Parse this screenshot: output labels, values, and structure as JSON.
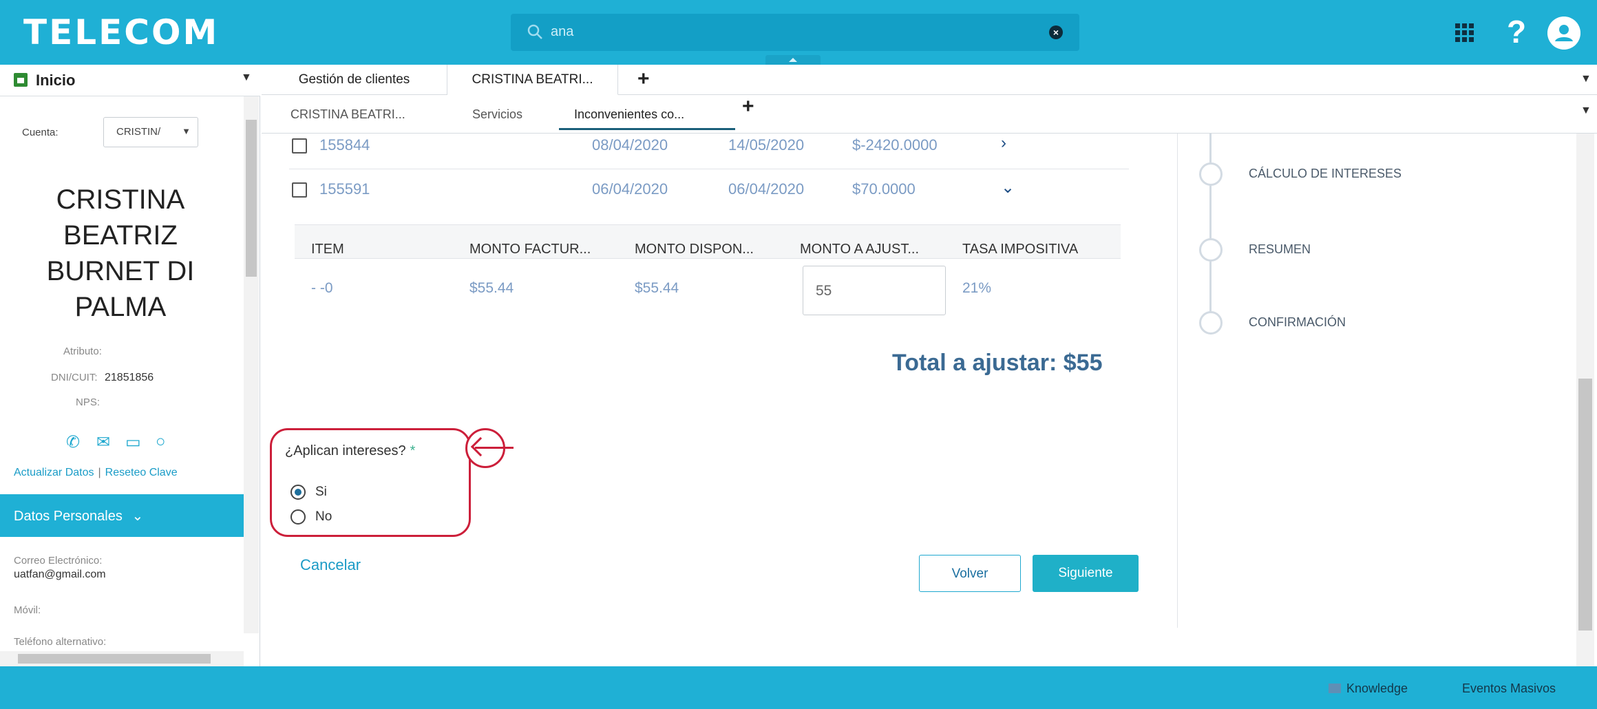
{
  "header": {
    "brand": "TELECOM",
    "search_value": "ana",
    "help_glyph": "?",
    "icons": [
      "search-icon",
      "clear-icon",
      "app-launcher-icon",
      "help-icon",
      "user-avatar-icon"
    ]
  },
  "left_panel": {
    "title": "Inicio",
    "cuenta_label": "Cuenta:",
    "cuenta_value": "CRISTIN/",
    "client_name": "CRISTINA BEATRIZ BURNET DI PALMA",
    "atributo_label": "Atributo:",
    "dni_label": "DNI/CUIT:",
    "dni_value": "21851856",
    "nps_label": "NPS:",
    "link_update": "Actualizar Datos",
    "link_separator": "|",
    "link_reset": "Reseteo Clave",
    "section_title": "Datos Personales",
    "email_label": "Correo Electrónico:",
    "email_value": "uatfan@gmail.com",
    "mobile_label": "Móvil:",
    "alt_phone_label": "Teléfono alternativo:"
  },
  "tabs_primary": [
    "Gestión de clientes",
    "CRISTINA BEATRI..."
  ],
  "tabs_secondary": [
    "CRISTINA BEATRI...",
    "Servicios",
    "Inconvenientes co..."
  ],
  "service_rows": [
    {
      "id": "155844",
      "date1": "08/04/2020",
      "date2": "14/05/2020",
      "amount": "$-2420.0000",
      "chevron": "›"
    },
    {
      "id": "155591",
      "date1": "06/04/2020",
      "date2": "06/04/2020",
      "amount": "$70.0000",
      "chevron": "⌄"
    }
  ],
  "detail_table": {
    "columns": [
      "ITEM",
      "MONTO FACTUR...",
      "MONTO DISPON...",
      "MONTO A AJUST...",
      "TASA IMPOSITIVA"
    ],
    "row": {
      "item": "- -0",
      "monto_facturado": "$55.44",
      "monto_disponible": "$55.44",
      "monto_ajustar": "55",
      "tasa": "21%"
    }
  },
  "total": "Total a ajustar: $55",
  "question": {
    "label": "¿Aplican intereses?",
    "required_mark": "*",
    "options": [
      "Si",
      "No"
    ],
    "selected": "Si"
  },
  "actions": {
    "cancel": "Cancelar",
    "back": "Volver",
    "next": "Siguiente"
  },
  "steps": [
    "CÁLCULO DE INTERESES",
    "RESUMEN",
    "CONFIRMACIÓN"
  ],
  "footer": {
    "knowledge": "Knowledge",
    "events": "Eventos Masivos"
  },
  "colors": {
    "brand": "#1fb0d5",
    "link": "#1b9bc6",
    "value_text": "#7b9bc4",
    "total_text": "#3b6a93",
    "annotation": "#cc1f3a"
  }
}
